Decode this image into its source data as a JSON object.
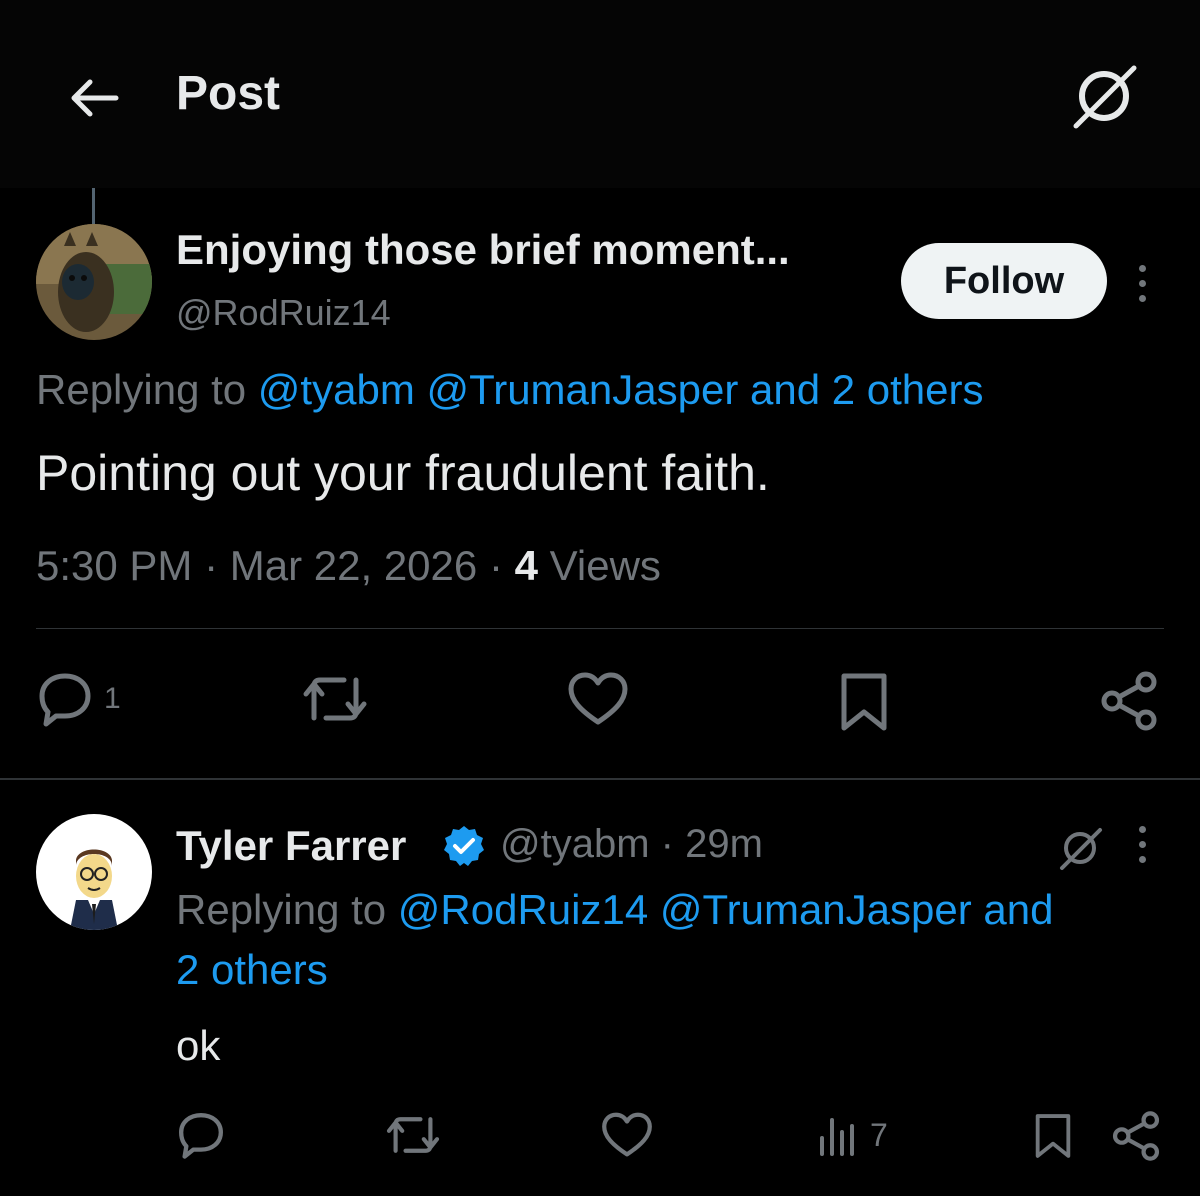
{
  "header": {
    "title": "Post",
    "back_icon": "arrow-left-icon",
    "grok_icon": "grok-icon"
  },
  "post": {
    "author_name": "Enjoying those brief moment...",
    "author_handle": "@RodRuiz14",
    "follow_label": "Follow",
    "replying_prefix": "Replying to",
    "replying_links": "@tyabm @TrumanJasper and 2 others",
    "text": "Pointing out your fraudulent faith.",
    "time": "5:30 PM",
    "sep1": "·",
    "date": "Mar 22, 2026",
    "sep2": "·",
    "views_count": "4",
    "views_label": "Views",
    "reply_count": "1"
  },
  "reply": {
    "author_name": "Tyler Farrer",
    "author_handle": "@tyabm",
    "sep": "·",
    "age": "29m",
    "replying_prefix": "Replying to",
    "replying_links_line1": "@RodRuiz14 @TrumanJasper and",
    "replying_links_line2": "2 others",
    "text": "ok",
    "views_count": "7"
  },
  "colors": {
    "background": "#000000",
    "text_primary": "#e7e9ea",
    "text_secondary": "#71767b",
    "link": "#1d9bf0",
    "divider": "#2f3336",
    "follow_bg": "#eff3f4",
    "verified": "#1d9bf0"
  }
}
